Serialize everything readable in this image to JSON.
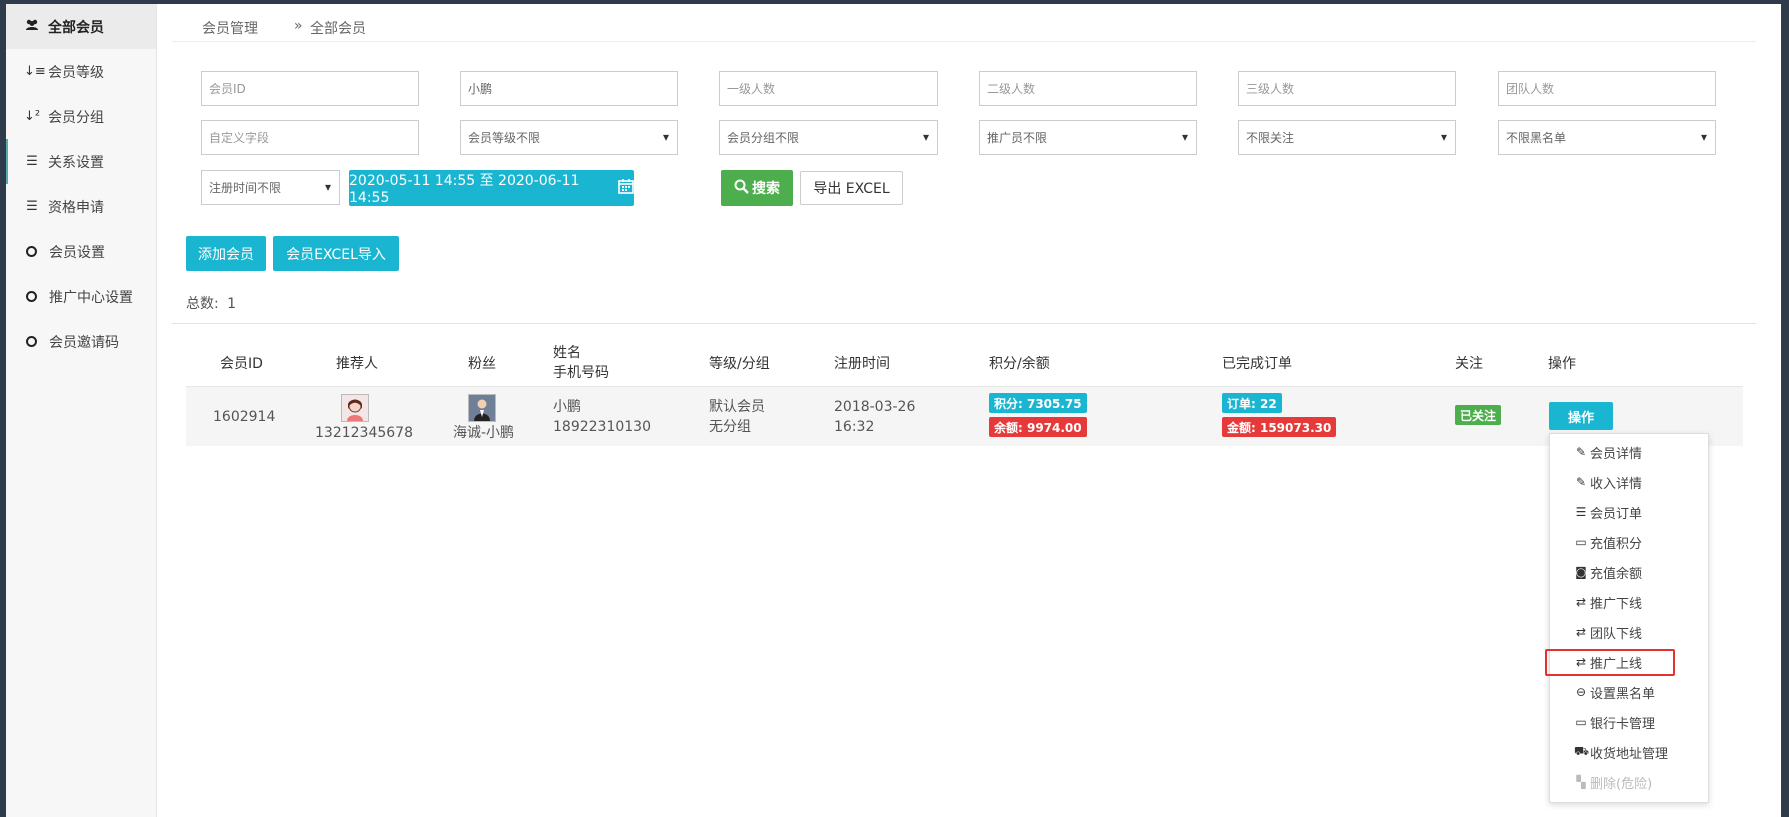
{
  "sidebar": {
    "items": [
      {
        "label": "全部会员",
        "icon": "users-icon"
      },
      {
        "label": "会员等级",
        "icon": "sort-amount-icon"
      },
      {
        "label": "会员分组",
        "icon": "sort-numeric-icon"
      },
      {
        "label": "关系设置",
        "icon": "sliders-icon"
      },
      {
        "label": "资格申请",
        "icon": "sliders-icon"
      },
      {
        "label": "会员设置",
        "icon": "circle-icon"
      },
      {
        "label": "推广中心设置",
        "icon": "circle-icon"
      },
      {
        "label": "会员邀请码",
        "icon": "circle-icon"
      }
    ]
  },
  "breadcrumb": {
    "parent": "会员管理",
    "separator": "»",
    "current": "全部会员"
  },
  "filters": {
    "member_id": {
      "value": "",
      "placeholder": "会员ID"
    },
    "name": {
      "value": "小鹏",
      "placeholder": ""
    },
    "level1": {
      "placeholder": "一级人数"
    },
    "level2": {
      "placeholder": "二级人数"
    },
    "level3": {
      "placeholder": "三级人数"
    },
    "team": {
      "placeholder": "团队人数"
    },
    "custom_field": {
      "placeholder": "自定义字段"
    },
    "member_level": {
      "selected": "会员等级不限"
    },
    "member_group": {
      "selected": "会员分组不限"
    },
    "promoter": {
      "selected": "推广员不限"
    },
    "follow": {
      "selected": "不限关注"
    },
    "blacklist": {
      "selected": "不限黑名单"
    },
    "reg_time": {
      "selected": "注册时间不限"
    },
    "date_range": "2020-05-11 14:55 至 2020-06-11 14:55"
  },
  "buttons": {
    "search": "搜索",
    "export": "导出 EXCEL",
    "add_member": "添加会员",
    "import_excel": "会员EXCEL导入"
  },
  "total": {
    "label": "总数:",
    "value": "1"
  },
  "table": {
    "headers": {
      "id": "会员ID",
      "referrer": "推荐人",
      "fans": "粉丝",
      "name": "姓名",
      "phone": "手机号码",
      "level_group": "等级/分组",
      "reg_time": "注册时间",
      "points_balance": "积分/余额",
      "orders": "已完成订单",
      "follow": "关注",
      "action": "操作"
    },
    "rows": [
      {
        "id": "1602914",
        "referrer": "13212345678",
        "fans": "海诚-小鹏",
        "name": "小鹏",
        "phone": "18922310130",
        "level": "默认会员",
        "group": "无分组",
        "reg_date": "2018-03-26",
        "reg_clock": "16:32",
        "points": "积分: 7305.75",
        "balance": "余额: 9974.00",
        "orders": "订单: 22",
        "amount": "金额: 159073.30",
        "follow": "已关注",
        "action": "操作"
      }
    ]
  },
  "dropdown": {
    "items": [
      {
        "label": "会员详情",
        "icon": "edit-icon"
      },
      {
        "label": "收入详情",
        "icon": "edit-icon"
      },
      {
        "label": "会员订单",
        "icon": "list-icon"
      },
      {
        "label": "充值积分",
        "icon": "credit-card-icon"
      },
      {
        "label": "充值余额",
        "icon": "money-icon"
      },
      {
        "label": "推广下线",
        "icon": "exchange-icon"
      },
      {
        "label": "团队下线",
        "icon": "exchange-icon"
      },
      {
        "label": "推广上线",
        "icon": "exchange-icon"
      },
      {
        "label": "设置黑名单",
        "icon": "minus-circle-icon"
      },
      {
        "label": "银行卡管理",
        "icon": "credit-card-icon"
      },
      {
        "label": "收货地址管理",
        "icon": "truck-icon"
      },
      {
        "label": "删除(危险)",
        "icon": "delete-icon"
      }
    ]
  },
  "colors": {
    "accent": "#1ab6d1",
    "success": "#4cae4c",
    "danger": "#e63a3a",
    "highlight": "#e53030"
  }
}
